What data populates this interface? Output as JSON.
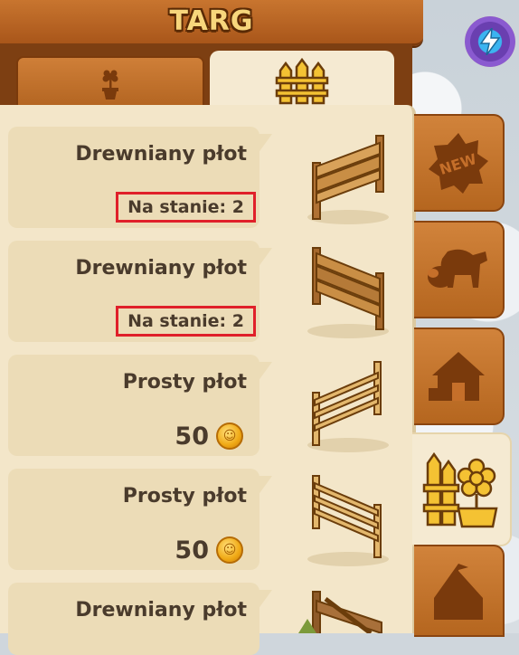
{
  "header": {
    "title": "TARG"
  },
  "tabs": [
    {
      "icon": "flower-pot-icon",
      "active": false
    },
    {
      "icon": "fence-icon",
      "active": true
    }
  ],
  "items": [
    {
      "name": "Drewniany płot",
      "stock": "Na stanie: 2",
      "fence": "wooden-fence"
    },
    {
      "name": "Drewniany płot",
      "stock": "Na stanie: 2",
      "fence": "wooden-fence"
    },
    {
      "name": "Prosty płot",
      "price": "50",
      "fence": "simple-fence"
    },
    {
      "name": "Prosty płot",
      "price": "50",
      "fence": "simple-fence"
    },
    {
      "name": "Drewniany płot",
      "fence": "wooden-gate"
    }
  ],
  "side_tabs": [
    {
      "icon": "new-badge-icon",
      "label": "NEW",
      "active": false
    },
    {
      "icon": "animals-icon",
      "active": false
    },
    {
      "icon": "house-icon",
      "active": false
    },
    {
      "icon": "decor-fence-flower-icon",
      "active": true
    },
    {
      "icon": "tent-icon",
      "active": false
    }
  ],
  "colors": {
    "wood": "#b5661f",
    "panel": "#f3e6c9",
    "highlight": "#e0202a",
    "coin": "#f0a915"
  }
}
